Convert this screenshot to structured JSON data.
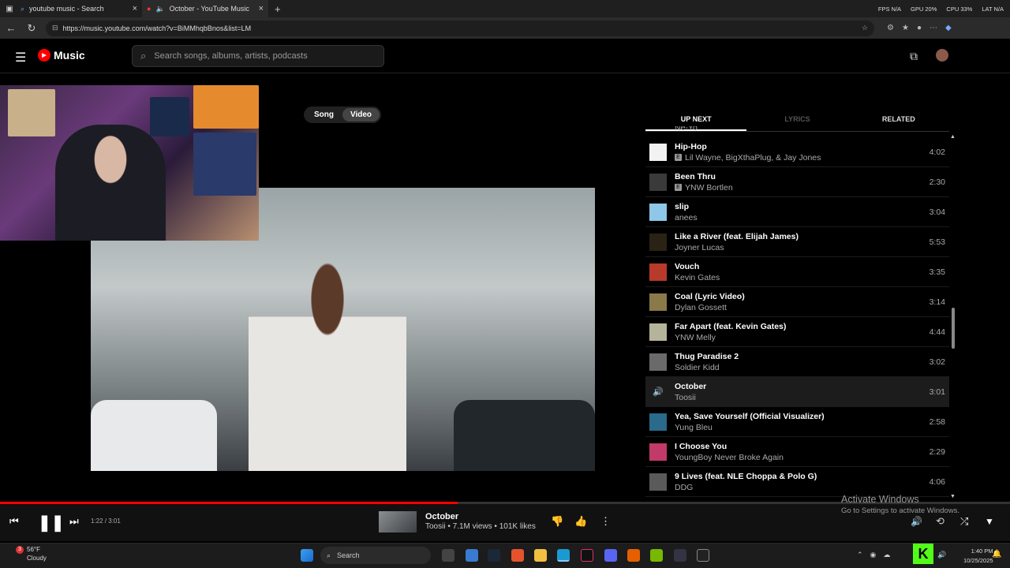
{
  "browser": {
    "tabs": [
      {
        "title": "youtube music - Search"
      },
      {
        "title": "October - YouTube Music"
      }
    ],
    "url": "https://music.youtube.com/watch?v=BiMMhqbBnos&list=LM",
    "stats": {
      "fps": "FPS N/A",
      "gpu": "GPU 20%",
      "cpu": "CPU 33%",
      "lat": "LAT N/A"
    }
  },
  "header": {
    "logo": "Music",
    "search_placeholder": "Search songs, albums, artists, podcasts"
  },
  "player_toggle": {
    "song": "Song",
    "video": "Video"
  },
  "queue_tabs": {
    "up_next": "UP NEXT",
    "lyrics": "LYRICS",
    "related": "RELATED"
  },
  "queue": {
    "partial_artist": "Ne-Yo",
    "items": [
      {
        "title": "Hip-Hop",
        "artist": "Lil Wayne, BigXthaPlug, & Jay Jones",
        "duration": "4:02",
        "explicit": true,
        "thumb_color": "#f2f2f2"
      },
      {
        "title": "Been Thru",
        "artist": "YNW Bortlen",
        "duration": "2:30",
        "explicit": true,
        "thumb_color": "#3a3a3a"
      },
      {
        "title": "slip",
        "artist": "anees",
        "duration": "3:04",
        "explicit": false,
        "thumb_color": "#8ec7e8"
      },
      {
        "title": "Like a River (feat. Elijah James)",
        "artist": "Joyner Lucas",
        "duration": "5:53",
        "explicit": false,
        "thumb_color": "#2a2214"
      },
      {
        "title": "Vouch",
        "artist": "Kevin Gates",
        "duration": "3:35",
        "explicit": false,
        "thumb_color": "#b83a2a"
      },
      {
        "title": "Coal (Lyric Video)",
        "artist": "Dylan Gossett",
        "duration": "3:14",
        "explicit": false,
        "thumb_color": "#8a7a4a"
      },
      {
        "title": "Far Apart (feat. Kevin Gates)",
        "artist": "YNW Melly",
        "duration": "4:44",
        "explicit": false,
        "thumb_color": "#b5b39a"
      },
      {
        "title": "Thug Paradise 2",
        "artist": "Soldier Kidd",
        "duration": "3:02",
        "explicit": false,
        "thumb_color": "#6a6a6a"
      },
      {
        "title": "October",
        "artist": "Toosii",
        "duration": "3:01",
        "explicit": false,
        "thumb_color": "#1c1c1c",
        "current": true
      },
      {
        "title": "Yea, Save Yourself (Official Visualizer)",
        "artist": "Yung Bleu",
        "duration": "2:58",
        "explicit": false,
        "thumb_color": "#2a6a8a"
      },
      {
        "title": "I Choose You",
        "artist": "YoungBoy Never Broke Again",
        "duration": "2:29",
        "explicit": false,
        "thumb_color": "#c23a6a"
      },
      {
        "title": "9 Lives (feat. NLE Choppa & Polo G)",
        "artist": "DDG",
        "duration": "4:06",
        "explicit": false,
        "thumb_color": "#5a5a5a"
      }
    ]
  },
  "player": {
    "time": "1:22 / 3:01",
    "progress": 0.453,
    "title": "October",
    "subtitle": "Toosii • 7.1M views • 101K likes"
  },
  "watermark": {
    "line1": "Activate Windows",
    "line2": "Go to Settings to activate Windows."
  },
  "taskbar": {
    "weather_temp": "56°F",
    "weather_desc": "Cloudy",
    "weather_badge": "3",
    "search": "Search",
    "time": "1:40 PM",
    "date": "10/25/2025"
  }
}
